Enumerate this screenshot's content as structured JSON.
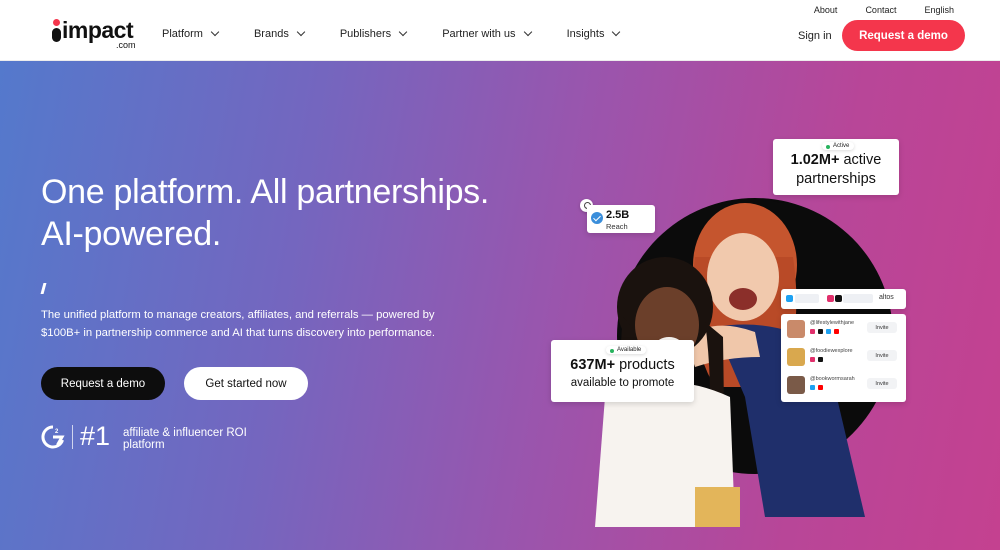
{
  "header": {
    "logo_text": "impact",
    "logo_sub": ".com",
    "nav": [
      {
        "label": "Platform"
      },
      {
        "label": "Brands"
      },
      {
        "label": "Publishers"
      },
      {
        "label": "Partner with us"
      },
      {
        "label": "Insights"
      }
    ],
    "util": {
      "about": "About",
      "contact": "Contact",
      "language": "English"
    },
    "sign_in": "Sign in",
    "cta": "Request a demo"
  },
  "hero": {
    "headline": "One platform. All partnerships. AI-powered.",
    "description": "The unified platform to manage creators, affiliates, and referrals — powered by $100B+ in partnership commerce and AI that turns discovery into performance.",
    "primary_cta": "Request a demo",
    "secondary_cta": "Get started now",
    "award": {
      "badge_icon": "g2-icon",
      "rank": "#1",
      "label": "affiliate & influencer ROI platform"
    }
  },
  "visual": {
    "reach": {
      "value": "2.5B",
      "label": "Reach"
    },
    "active_card": {
      "badge": "Active",
      "value": "1.02M+",
      "text": "active partnerships"
    },
    "products_card": {
      "badge": "Available",
      "value": "637M+",
      "text_main": "products",
      "text_sub": "available to promote"
    },
    "search_term": "altos",
    "creators": [
      {
        "handle": "@lifestylewithjane",
        "invite": "Invite",
        "avatar_color": "#c98a6a"
      },
      {
        "handle": "@foodiewexplore",
        "invite": "Invite",
        "avatar_color": "#d9a84e"
      },
      {
        "handle": "@bookwormsarah",
        "invite": "Invite",
        "avatar_color": "#7a5a48"
      }
    ]
  },
  "colors": {
    "brand_red": "#f4364c",
    "gradient_start": "#5479cc",
    "gradient_end": "#c44190"
  }
}
